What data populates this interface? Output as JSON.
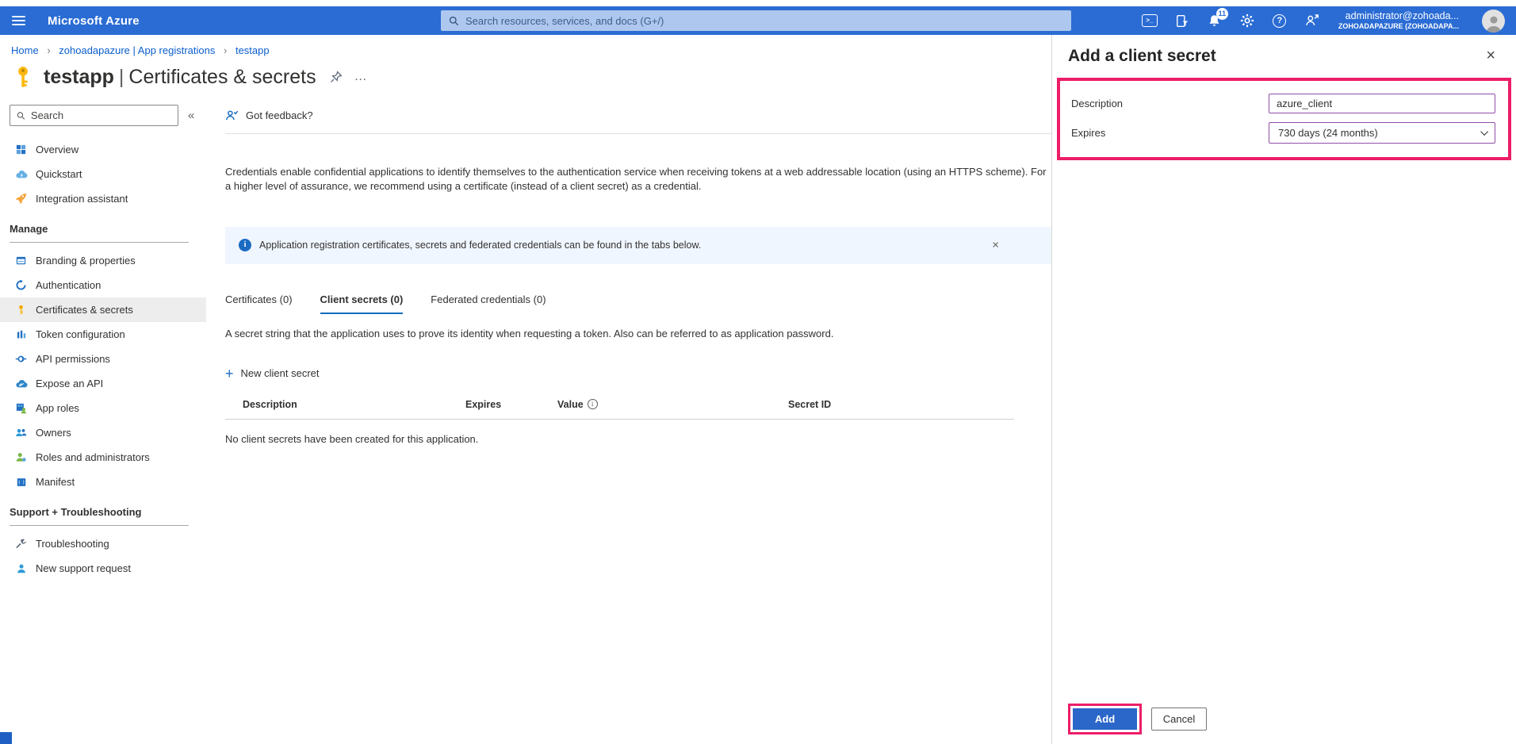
{
  "topbar": {
    "product": "Microsoft Azure",
    "search_placeholder": "Search resources, services, and docs (G+/)",
    "cloud_shell_glyph": ">_",
    "notification_count": "11",
    "help_glyph": "?",
    "account": {
      "email": "administrator@zohoada...",
      "tenant": "ZOHOADAPAZURE (ZOHOADAPA..."
    },
    "icons": [
      "cloud-shell-icon",
      "directory-filter-icon",
      "notifications-icon",
      "settings-gear-icon",
      "help-icon",
      "feedback-icon"
    ]
  },
  "breadcrumb": {
    "separator": "›",
    "items": [
      "Home",
      "zohoadapazure | App registrations",
      "testapp"
    ]
  },
  "page": {
    "icon": "key-icon",
    "title_app": "testapp",
    "title_separator": "|",
    "title_section": "Certificates & secrets",
    "more_glyph": "…"
  },
  "sidebar": {
    "search_placeholder": "Search",
    "collapse_glyph": "«",
    "groups": [
      {
        "header": "",
        "items": [
          "Overview",
          "Quickstart",
          "Integration assistant"
        ]
      },
      {
        "header": "Manage",
        "items": [
          "Branding & properties",
          "Authentication",
          "Certificates & secrets",
          "Token configuration",
          "API permissions",
          "Expose an API",
          "App roles",
          "Owners",
          "Roles and administrators",
          "Manifest"
        ]
      },
      {
        "header": "Support + Troubleshooting",
        "items": [
          "Troubleshooting",
          "New support request"
        ]
      }
    ],
    "selected_item": "Certificates & secrets"
  },
  "main": {
    "feedback_label": "Got feedback?",
    "intro": "Credentials enable confidential applications to identify themselves to the authentication service when receiving tokens at a web addressable location (using an HTTPS scheme). For a higher level of assurance, we recommend using a certificate (instead of a client secret) as a credential.",
    "banner_text": "Application registration certificates, secrets and federated credentials can be found in the tabs below.",
    "banner_info_glyph": "i",
    "banner_close_glyph": "×",
    "tabs": [
      {
        "label": "Certificates (0)",
        "active": false
      },
      {
        "label": "Client secrets (0)",
        "active": true
      },
      {
        "label": "Federated credentials (0)",
        "active": false
      }
    ],
    "tab_description": "A secret string that the application uses to prove its identity when requesting a token. Also can be referred to as application password.",
    "new_secret_plus": "+",
    "new_secret_label": "New client secret",
    "table": {
      "headers": [
        "Description",
        "Expires",
        "Value",
        "Secret ID"
      ],
      "value_info_glyph": "i",
      "empty_message": "No client secrets have been created for this application."
    }
  },
  "panel": {
    "title": "Add a client secret",
    "close_glyph": "×",
    "fields": {
      "description": {
        "label": "Description",
        "value": "azure_client"
      },
      "expires": {
        "label": "Expires",
        "value": "730 days (24 months)"
      }
    },
    "buttons": {
      "add": "Add",
      "cancel": "Cancel"
    }
  },
  "colors": {
    "header_blue": "#2a6cd4",
    "accent_blue": "#0f6cbd",
    "link_blue": "#0b5fce",
    "annotation_pink": "#ec1e68",
    "add_button_blue": "#2b66c9",
    "banner_bg": "#f0f6ff",
    "key_gold": "#fdb913"
  }
}
